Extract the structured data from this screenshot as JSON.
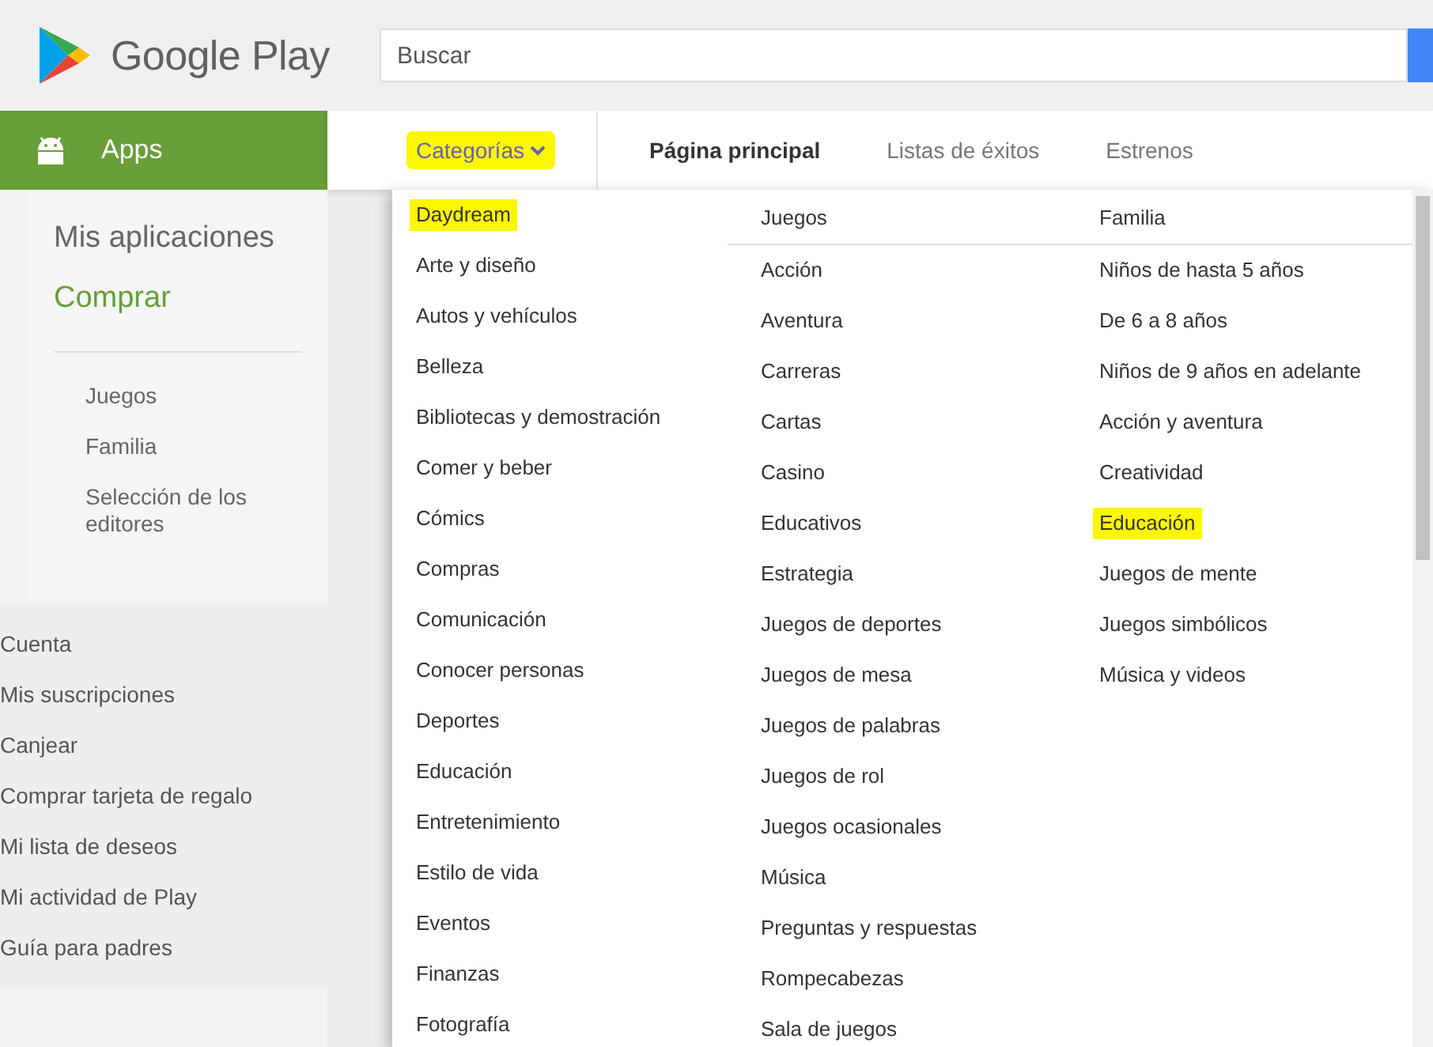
{
  "header": {
    "brand": "Google Play",
    "search": {
      "placeholder": "Buscar"
    }
  },
  "section": {
    "label": "Apps"
  },
  "nav": [
    {
      "label": "Categorías",
      "kind": "dropdown",
      "highlighted": true,
      "selected": false
    },
    {
      "label": "Página principal",
      "kind": "link",
      "highlighted": false,
      "selected": true
    },
    {
      "label": "Listas de éxitos",
      "kind": "link",
      "highlighted": false,
      "selected": false
    },
    {
      "label": "Estrenos",
      "kind": "link",
      "highlighted": false,
      "selected": false
    }
  ],
  "sidebar": {
    "primary": [
      {
        "label": "Mis aplicaciones",
        "selected": false
      },
      {
        "label": "Comprar",
        "selected": true
      }
    ],
    "secondary": [
      "Juegos",
      "Familia",
      "Selección de los editores"
    ],
    "account": [
      "Cuenta",
      "Mis suscripciones",
      "Canjear",
      "Comprar tarjeta de regalo",
      "Mi lista de deseos",
      "Mi actividad de Play",
      "Guía para padres"
    ]
  },
  "categories": [
    {
      "items": [
        {
          "label": "Daydream",
          "highlighted": true
        },
        {
          "label": "Arte y diseño",
          "highlighted": false
        },
        {
          "label": "Autos y vehículos",
          "highlighted": false
        },
        {
          "label": "Belleza",
          "highlighted": false
        },
        {
          "label": "Bibliotecas y demostración",
          "highlighted": false
        },
        {
          "label": "Comer y beber",
          "highlighted": false
        },
        {
          "label": "Cómics",
          "highlighted": false
        },
        {
          "label": "Compras",
          "highlighted": false
        },
        {
          "label": "Comunicación",
          "highlighted": false
        },
        {
          "label": "Conocer personas",
          "highlighted": false
        },
        {
          "label": "Deportes",
          "highlighted": false
        },
        {
          "label": "Educación",
          "highlighted": false
        },
        {
          "label": "Entretenimiento",
          "highlighted": false
        },
        {
          "label": "Estilo de vida",
          "highlighted": false
        },
        {
          "label": "Eventos",
          "highlighted": false
        },
        {
          "label": "Finanzas",
          "highlighted": false
        },
        {
          "label": "Fotografía",
          "highlighted": false
        }
      ]
    },
    {
      "heading": "Juegos",
      "items": [
        {
          "label": "Acción",
          "highlighted": false
        },
        {
          "label": "Aventura",
          "highlighted": false
        },
        {
          "label": "Carreras",
          "highlighted": false
        },
        {
          "label": "Cartas",
          "highlighted": false
        },
        {
          "label": "Casino",
          "highlighted": false
        },
        {
          "label": "Educativos",
          "highlighted": false
        },
        {
          "label": "Estrategia",
          "highlighted": false
        },
        {
          "label": "Juegos de deportes",
          "highlighted": false
        },
        {
          "label": "Juegos de mesa",
          "highlighted": false
        },
        {
          "label": "Juegos de palabras",
          "highlighted": false
        },
        {
          "label": "Juegos de rol",
          "highlighted": false
        },
        {
          "label": "Juegos ocasionales",
          "highlighted": false
        },
        {
          "label": "Música",
          "highlighted": false
        },
        {
          "label": "Preguntas y respuestas",
          "highlighted": false
        },
        {
          "label": "Rompecabezas",
          "highlighted": false
        },
        {
          "label": "Sala de juegos",
          "highlighted": false
        }
      ]
    },
    {
      "heading": "Familia",
      "items": [
        {
          "label": "Niños de hasta 5 años",
          "highlighted": false
        },
        {
          "label": "De 6 a 8 años",
          "highlighted": false
        },
        {
          "label": "Niños de 9 años en adelante",
          "highlighted": false
        },
        {
          "label": "Acción y aventura",
          "highlighted": false
        },
        {
          "label": "Creatividad",
          "highlighted": false
        },
        {
          "label": "Educación",
          "highlighted": true
        },
        {
          "label": "Juegos de mente",
          "highlighted": false
        },
        {
          "label": "Juegos simbólicos",
          "highlighted": false
        },
        {
          "label": "Música y videos",
          "highlighted": false
        }
      ]
    }
  ]
}
